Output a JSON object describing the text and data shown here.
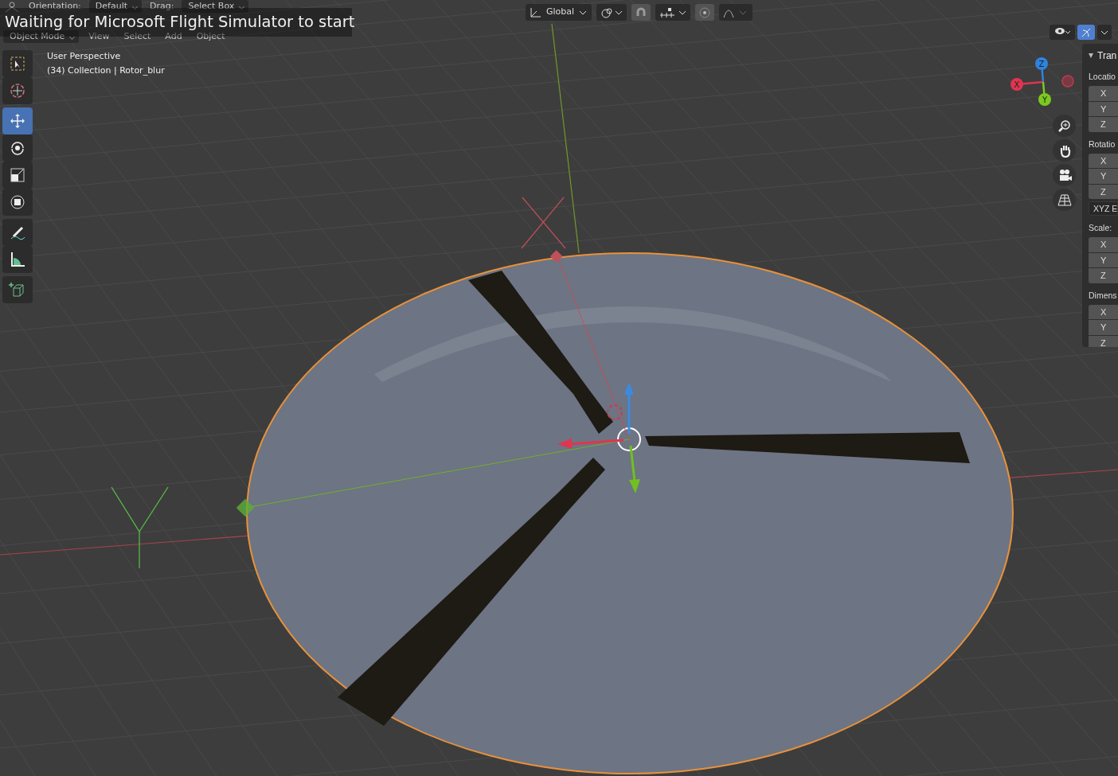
{
  "tool_header": {
    "settings": [
      {
        "kind": "label",
        "text": "Orientation:"
      },
      {
        "kind": "dropdown",
        "text": "Default"
      },
      {
        "kind": "label",
        "text": "Drag:"
      },
      {
        "kind": "dropdown",
        "text": "Select Box"
      }
    ],
    "menus": [
      {
        "kind": "dropdown",
        "text": "Object Mode"
      },
      {
        "kind": "menu",
        "text": "View"
      },
      {
        "kind": "menu",
        "text": "Select"
      },
      {
        "kind": "menu",
        "text": "Add"
      },
      {
        "kind": "menu",
        "text": "Object"
      }
    ]
  },
  "banner": {
    "text": "Waiting for Microsoft Flight Simulator to start"
  },
  "transform_orientation": {
    "text": "Global"
  },
  "viewport_info": [
    "User Perspective",
    "(34) Collection | Rotor_blur"
  ],
  "toolbar": [
    {
      "kind": "select",
      "selected": false
    },
    {
      "kind": "cursor",
      "selected": false
    },
    {
      "kind": "move",
      "selected": true
    },
    {
      "kind": "rotate",
      "selected": false
    },
    {
      "kind": "scale",
      "selected": false
    },
    {
      "kind": "transform",
      "selected": false
    },
    {
      "kind": "annotate",
      "selected": false
    },
    {
      "kind": "measure",
      "selected": false
    },
    {
      "kind": "add-cube",
      "selected": false
    }
  ],
  "gizmo_toggle": {
    "on": true
  },
  "axes": [
    {
      "label": "Z",
      "color": "#2f83e0"
    },
    {
      "label": "X",
      "color": "#e0354f"
    },
    {
      "label": "Y",
      "color": "#7bc91f"
    }
  ],
  "sidebar": {
    "title": "Tran",
    "expanded": true,
    "groups": [
      {
        "title": "Locatio",
        "fields": [
          "X",
          "Y",
          "Z"
        ]
      },
      {
        "title": "Rotatio",
        "fields": [
          "X",
          "Y",
          "Z"
        ],
        "mode": "XYZ E"
      },
      {
        "title": "Scale:",
        "fields": [
          "X",
          "Y",
          "Z"
        ]
      },
      {
        "title": "Dimens",
        "fields": [
          "X",
          "Y",
          "Z"
        ]
      }
    ]
  }
}
